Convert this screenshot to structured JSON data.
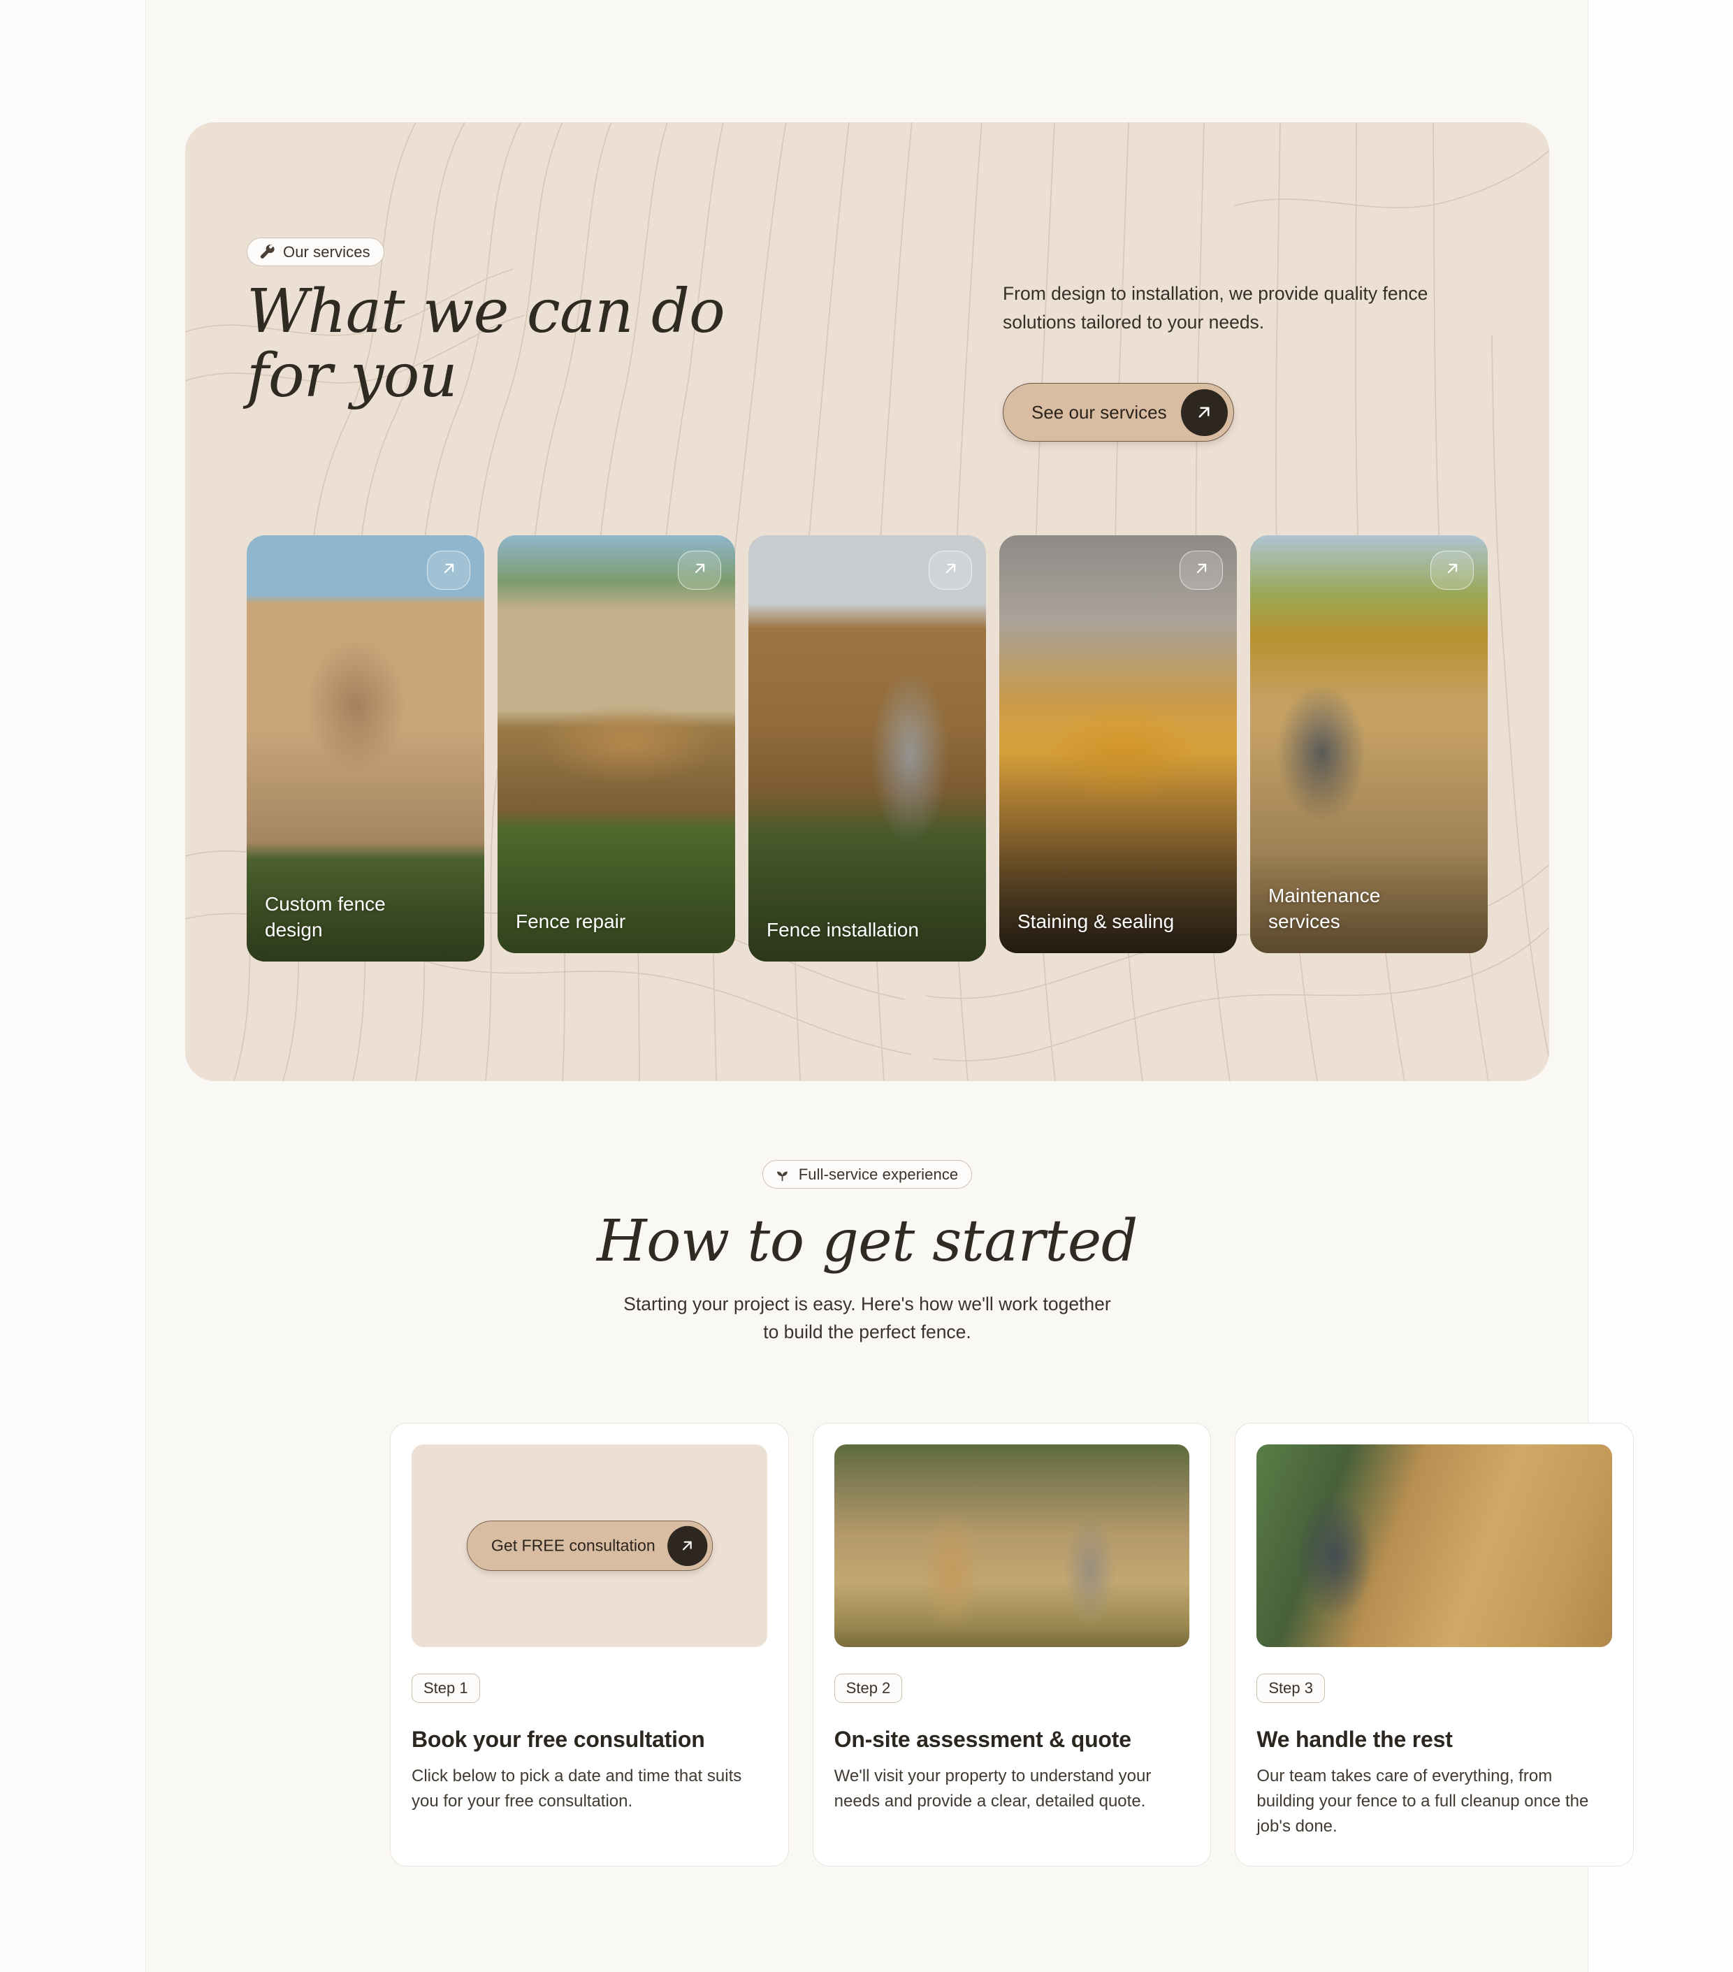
{
  "services_section": {
    "badge": {
      "label": "Our services",
      "icon": "wrench-icon"
    },
    "title_line1": "What we can do",
    "title_line2": "for you",
    "description": "From design to installation, we provide quality fence solutions tailored to your needs.",
    "cta": {
      "label": "See our services",
      "icon": "arrow-up-right-icon"
    },
    "cards": [
      {
        "label": "Custom fence design",
        "arrow_icon": "arrow-up-right-icon",
        "photo": "worker-with-blueprint-at-wooden-fence"
      },
      {
        "label": "Fence repair",
        "arrow_icon": "arrow-up-right-icon",
        "photo": "stacked-lumber-boards-on-pallet-in-grass"
      },
      {
        "label": "Fence installation",
        "arrow_icon": "arrow-up-right-icon",
        "photo": "two-workers-installing-horizontal-slat-fence"
      },
      {
        "label": "Staining & sealing",
        "arrow_icon": "arrow-up-right-icon",
        "photo": "gloved-hands-brushing-stain-onto-plank"
      },
      {
        "label": "Maintenance services",
        "arrow_icon": "arrow-up-right-icon",
        "photo": "worker-drilling-fence-board"
      }
    ]
  },
  "howto_section": {
    "badge": {
      "label": "Full-service experience",
      "icon": "sprout-icon"
    },
    "title": "How to get started",
    "subtitle": "Starting your project is easy. Here's how we'll work together to build the perfect fence.",
    "steps": [
      {
        "chip": "Step 1",
        "title": "Book your free consultation",
        "description": "Click below to pick a date and time that suits you for your free consultation.",
        "media_type": "cta",
        "cta": {
          "label": "Get FREE consultation",
          "icon": "arrow-up-right-icon"
        }
      },
      {
        "chip": "Step 2",
        "title": "On-site assessment & quote",
        "description": "We'll visit your property to understand your needs and provide a clear, detailed quote.",
        "media_type": "photo",
        "photo": "two-men-talking-in-front-yard-at-golden-hour"
      },
      {
        "chip": "Step 3",
        "title": "We handle the rest",
        "description": "Our team takes care of everything, from building your fence to a full cleanup once the job's done.",
        "media_type": "photo",
        "photo": "two-workers-in-hardhats-aligning-fence-boards"
      }
    ]
  },
  "colors": {
    "page_background": "#faf8f5",
    "hero_panel": "#ece0d5",
    "accent_tan": "#d9bda3",
    "dark": "#2e2720",
    "text": "#2f2a22",
    "card_white": "#ffffff",
    "border": "#eae3da"
  }
}
